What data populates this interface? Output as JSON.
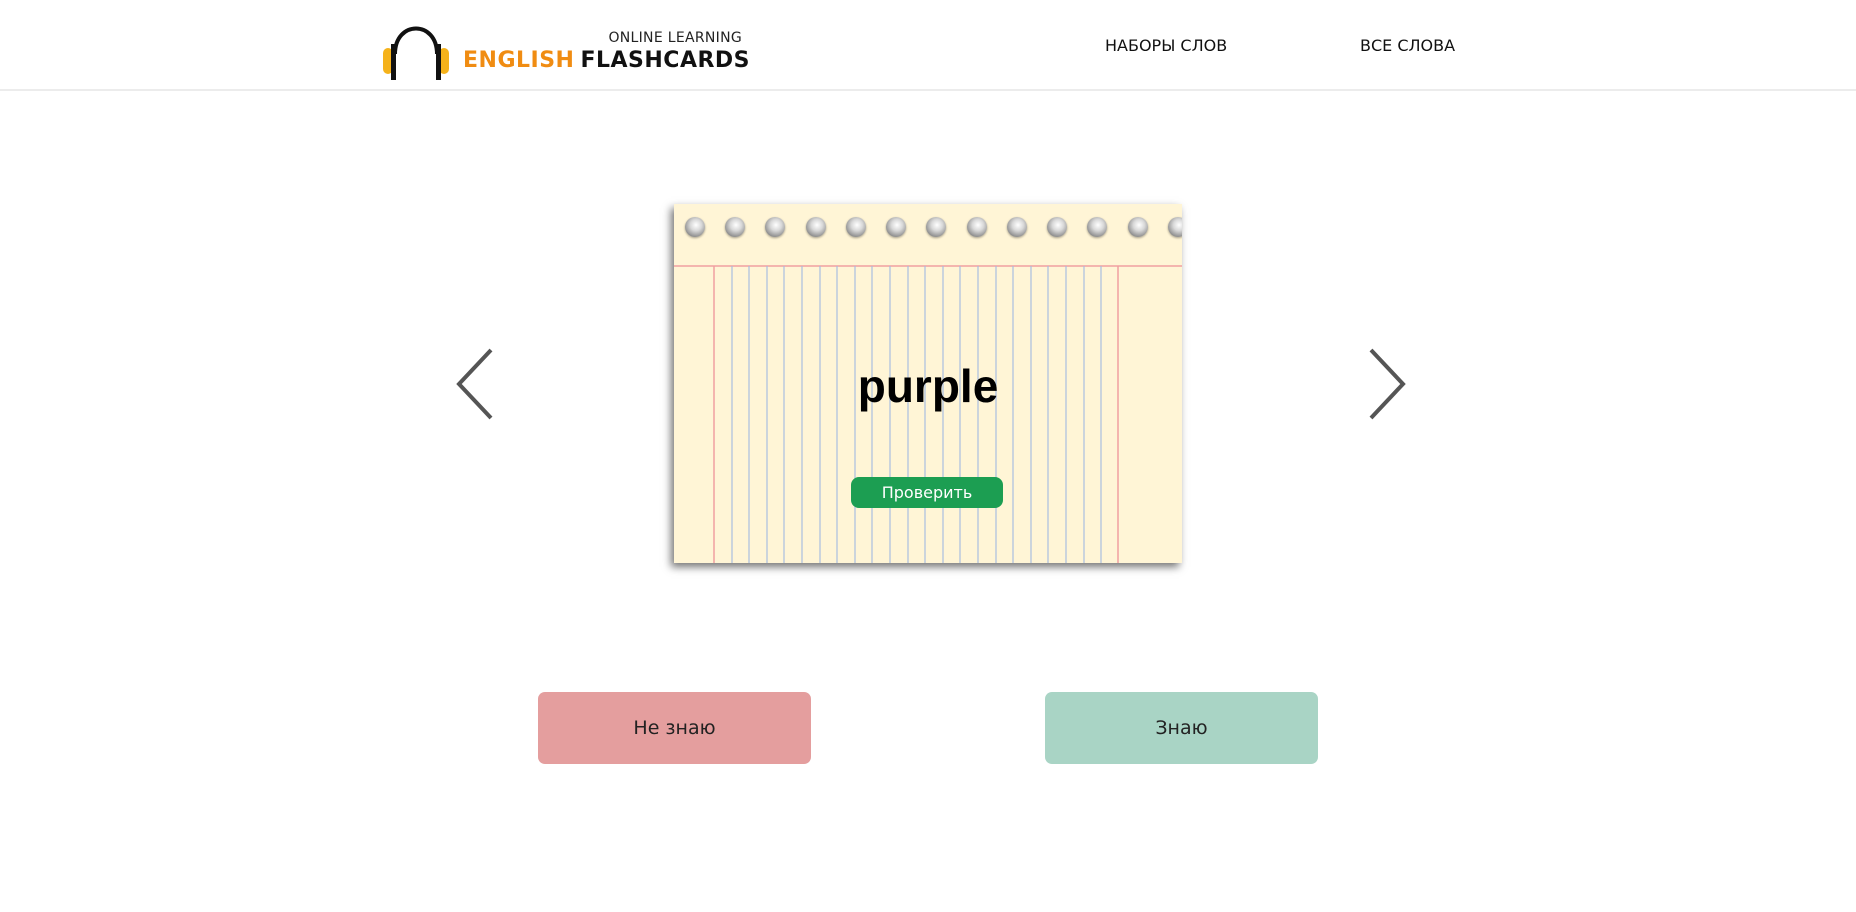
{
  "header": {
    "logo_top": "ONLINE LEARNING",
    "logo_word1": "ENGLISH",
    "logo_word2": "FLASHCARDS",
    "nav": [
      {
        "label": "НАБОРЫ СЛОВ"
      },
      {
        "label": "ВСЕ СЛОВА"
      }
    ]
  },
  "card": {
    "word": "purple",
    "check_label": "Проверить"
  },
  "answers": {
    "dont_know_label": "Не знаю",
    "know_label": "Знаю"
  },
  "icons": {
    "logo": "headphones-icon",
    "prev": "chevron-left-icon",
    "next": "chevron-right-icon"
  },
  "colors": {
    "brand_orange": "#f08c12",
    "card_bg": "#fff5d6",
    "check_button": "#1c9e52",
    "dont_know_button": "#e49e9e",
    "know_button": "#a9d4c5"
  }
}
